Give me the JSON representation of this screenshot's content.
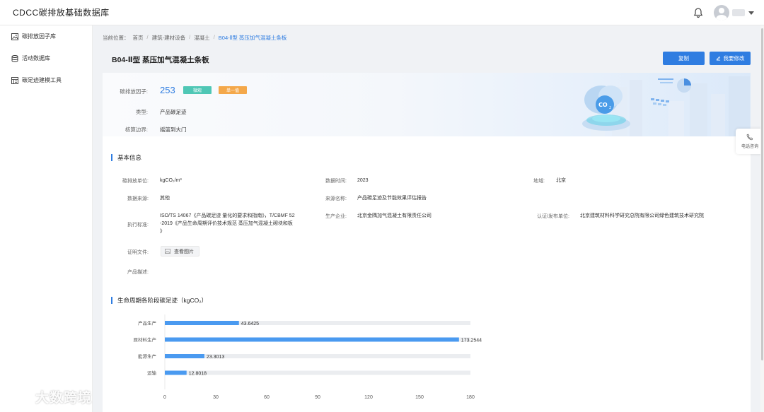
{
  "app": {
    "title": "CDCC碳排放基础数据库"
  },
  "sidebar": {
    "items": [
      {
        "label": "碳排放因子库",
        "icon": "image-icon"
      },
      {
        "label": "活动数据库",
        "icon": "database-icon"
      },
      {
        "label": "碳足迹建模工具",
        "icon": "model-icon"
      }
    ]
  },
  "breadcrumb": {
    "prefix": "当前位置：",
    "items": [
      "首页",
      "建筑-建材设备",
      "混凝土",
      "B04-Ⅱ型 蒸压加气混凝土条板"
    ],
    "separator": "/"
  },
  "page": {
    "title": "B04-Ⅱ型 蒸压加气混凝土条板",
    "copy_label": "复制",
    "edit_label": "我要修改"
  },
  "hero": {
    "factor_label": "碳排放因子:",
    "factor_value": "253",
    "tag1": "微观",
    "tag2": "单一值",
    "type_label": "类型:",
    "type_value": "产品碳足迹",
    "boundary_label": "核算边界:",
    "boundary_value": "摇篮到大门"
  },
  "basic": {
    "title": "基本信息",
    "unit_label": "碳排放单位:",
    "unit_value": "kgCO₂/m³",
    "time_label": "数据时间:",
    "time_value": "2023",
    "region_label": "地域:",
    "region_value": "北京",
    "source_label": "数据来源:",
    "source_value": "其他",
    "source_name_label": "来源名称:",
    "source_name_value": "产品碳足迹及节能效果评估报告",
    "standard_label": "执行标准:",
    "standard_line1": "ISO/TS 14067《产品碳足迹 量化的要求和指南》，T/CBMF 52",
    "standard_line2": "-2019《产品生命周期评价技术规范 蒸压加气混凝土砌块和板",
    "standard_line3": "》",
    "producer_label": "生产企业:",
    "producer_value": "北京金隅加气混凝土有限责任公司",
    "cert_label": "认证/发布单位:",
    "cert_value": "北京建筑材料科学研究总院有限公司绿色建筑技术研究院",
    "proof_label": "证明文件:",
    "proof_button": "查看图片",
    "desc_label": "产品描述:"
  },
  "lifecycle": {
    "title": "生命周期各阶段碳足迹（kgCO₂）"
  },
  "chart_data": {
    "type": "bar",
    "orientation": "horizontal",
    "categories": [
      "产品生产",
      "原材料生产",
      "能源生产",
      "运输"
    ],
    "values": [
      43.6425,
      173.2544,
      23.3013,
      12.8018
    ],
    "value_labels": [
      "43.6425",
      "173.2544",
      "23.3013",
      "12.8018"
    ],
    "xlim": [
      0,
      180
    ],
    "xticks": [
      0,
      30,
      60,
      90,
      120,
      150,
      180
    ],
    "bar_color": "#4a9af0",
    "track_color": "#ebedf0",
    "title": "",
    "xlabel": "",
    "ylabel": ""
  },
  "float": {
    "phone_label": "电话咨询"
  },
  "watermark": {
    "text": "大数跨境"
  },
  "colors": {
    "accent": "#2f7de1",
    "tag_green": "#4fc7b5",
    "tag_orange": "#f4a84a"
  }
}
